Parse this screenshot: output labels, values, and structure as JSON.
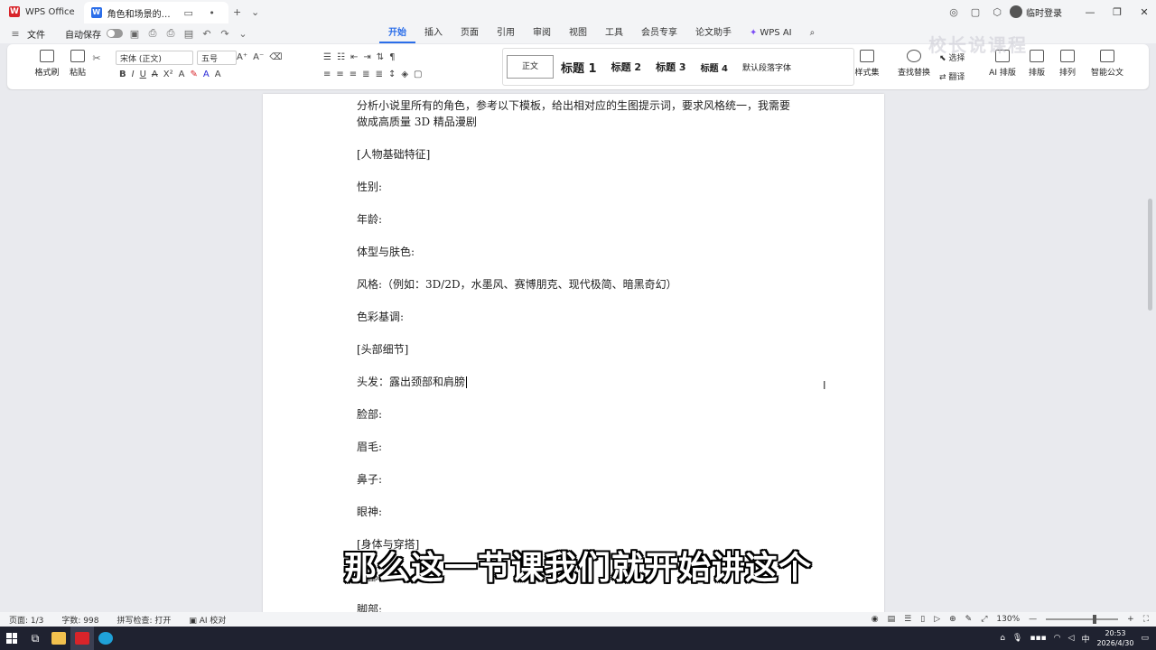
{
  "titlebar": {
    "app_name": "WPS Office",
    "doc_tab_title": "角色和场景的完整提示词.docx",
    "user_label": "临时登录"
  },
  "menubar": {
    "file_label": "文件",
    "autosave_label": "自动保存",
    "tabs": [
      "开始",
      "插入",
      "页面",
      "引用",
      "审阅",
      "视图",
      "工具",
      "会员专享",
      "论文助手",
      "WPS AI"
    ],
    "active_tab": "开始"
  },
  "ribbon": {
    "format_painter": "格式刷",
    "paste": "粘贴",
    "font_name": "宋体 (正文)",
    "font_size": "五号",
    "styles": [
      "正文",
      "标题 1",
      "标题 2",
      "标题 3",
      "标题 4",
      "默认段落字体"
    ],
    "style_set": "样式集",
    "find_replace": "查找替换",
    "select": "选择",
    "translate": "翻译",
    "ai_layout": "AI 排版",
    "layout": "排版",
    "arrange": "排列",
    "smart_doc": "智能公文"
  },
  "document": {
    "paragraphs": [
      "分析小说里所有的角色，参考以下模板，给出相对应的生图提示词，要求风格统一，我需要做成高质量 3D 精品漫剧",
      "[人物基础特征]",
      "性别:",
      "年龄:",
      "体型与肤色:",
      "风格:（例如：3D/2D，水墨风、赛博朋克、现代极简、暗黑奇幻）",
      "色彩基调:",
      "[头部细节]",
      "头发：露出颈部和肩膀",
      "脸部:",
      "眉毛:",
      "鼻子:",
      "眼神:",
      "[身体与穿搭]",
      "上部:",
      "脚部:"
    ]
  },
  "subtitle": "那么这一节课我们就开始讲这个",
  "watermark": "校长说课程",
  "statusbar": {
    "page": "页面: 1/3",
    "word_count": "字数: 998",
    "spell_check": "拼写检查: 打开",
    "proofread": "AI 校对",
    "zoom": "130%"
  },
  "taskbar": {
    "time": "20:53",
    "date": "2026/4/30",
    "ime": "中"
  }
}
